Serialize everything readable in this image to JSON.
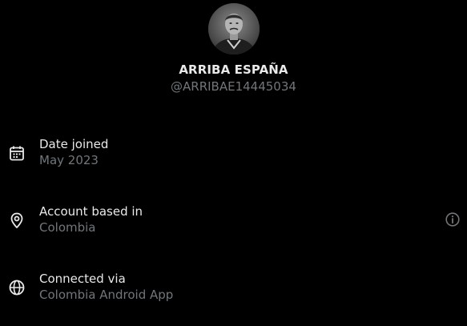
{
  "profile": {
    "display_name": "ARRIBA ESPAÑA",
    "handle": "@ARRIBAE14445034"
  },
  "about": {
    "date_joined": {
      "label": "Date joined",
      "value": "May 2023",
      "icon": "calendar-icon"
    },
    "account_based_in": {
      "label": "Account based in",
      "value": "Colombia",
      "icon": "location-pin-icon",
      "trailing_icon": "info-icon"
    },
    "connected_via": {
      "label": "Connected via",
      "value": "Colombia Android App",
      "icon": "globe-icon"
    }
  },
  "colors": {
    "background": "#000000",
    "primary_text": "#e7e9ea",
    "secondary_text": "#71767b"
  }
}
